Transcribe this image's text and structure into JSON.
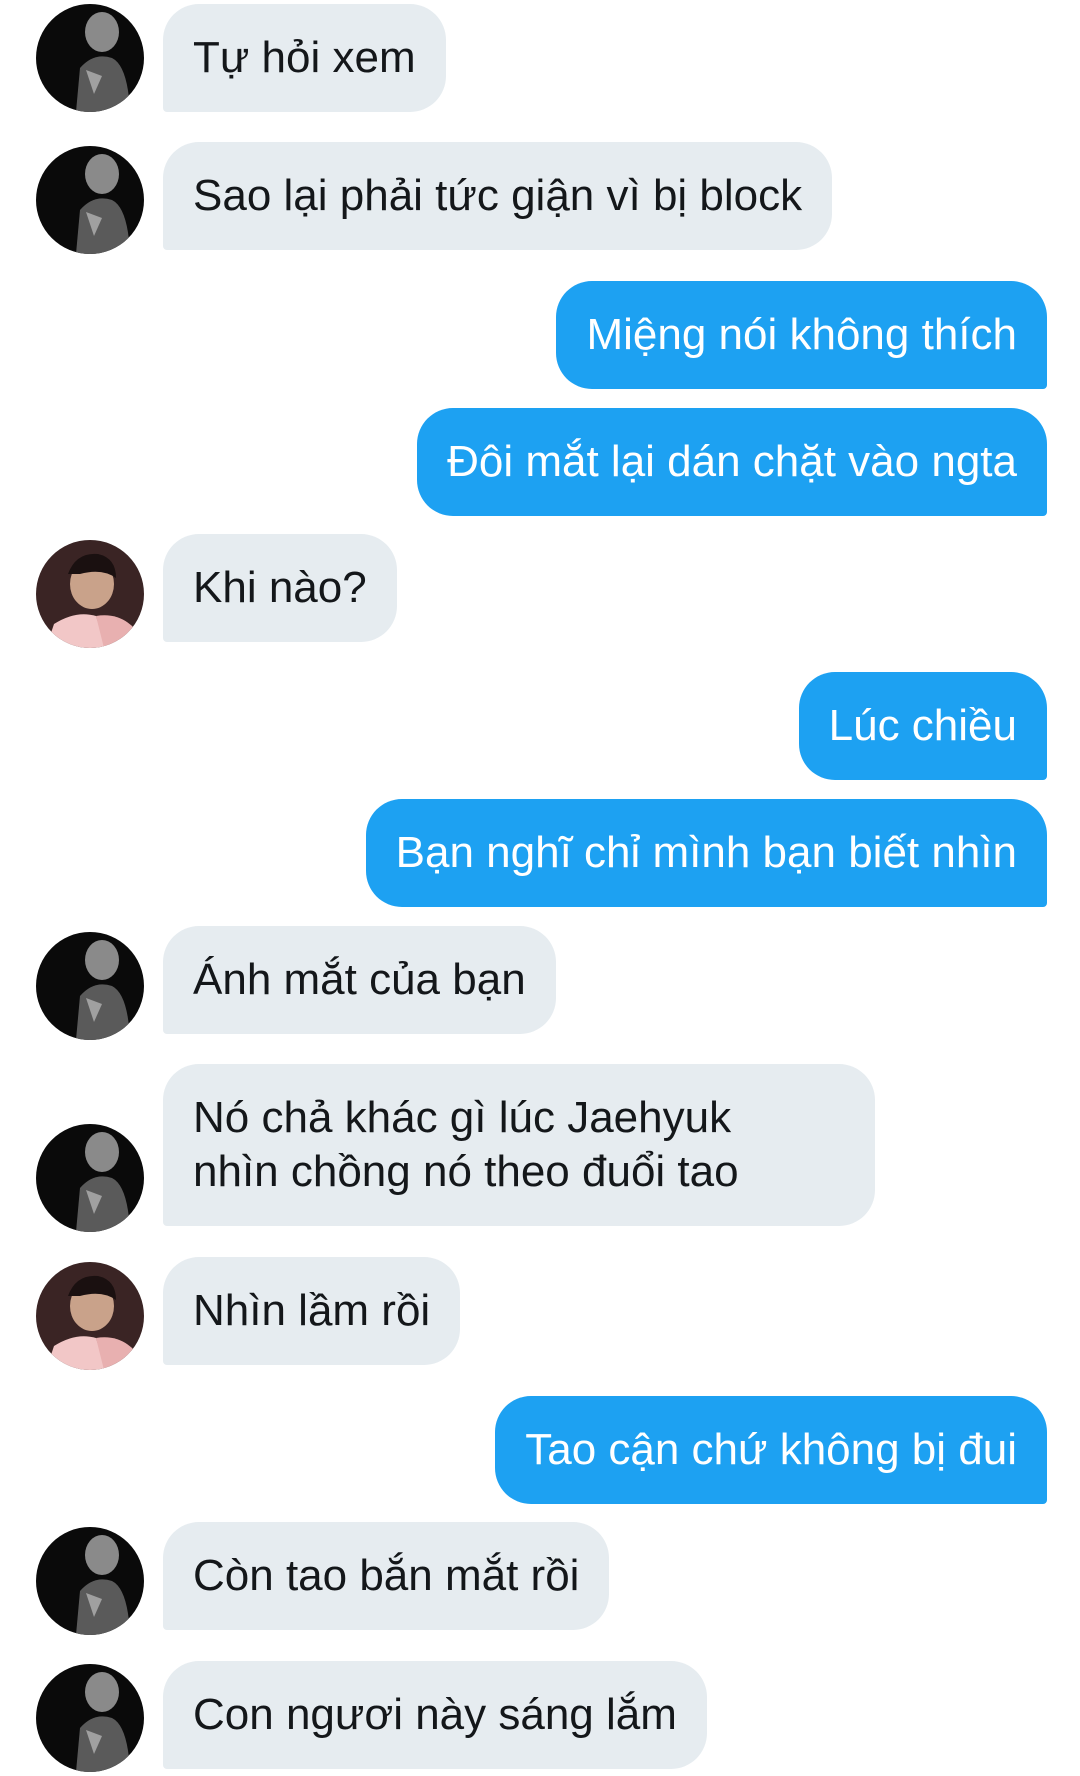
{
  "conversation": {
    "messages": [
      {
        "side": "in",
        "avatar": "dark-portrait",
        "text": "Tự hỏi xem"
      },
      {
        "side": "in",
        "avatar": "dark-portrait",
        "text": "Sao lại phải tức giận vì bị block"
      },
      {
        "side": "out",
        "text": "Miệng nói không thích"
      },
      {
        "side": "out",
        "text": "Đôi mắt lại dán chặt vào ngta"
      },
      {
        "side": "in",
        "avatar": "pink-portrait",
        "text": "Khi nào?"
      },
      {
        "side": "out",
        "text": "Lúc chiều"
      },
      {
        "side": "out",
        "text": "Bạn nghĩ chỉ mình bạn biết nhìn"
      },
      {
        "side": "in",
        "avatar": "dark-portrait",
        "text": "Ánh mắt của bạn"
      },
      {
        "side": "in",
        "avatar": "dark-portrait",
        "lines": [
          "Nó chả khác gì lúc Jaehyuk",
          "nhìn chồng nó theo đuổi tao"
        ]
      },
      {
        "side": "in",
        "avatar": "pink-portrait",
        "text": "Nhìn lầm rồi"
      },
      {
        "side": "out",
        "text": "Tao cận chứ không bị đui"
      },
      {
        "side": "in",
        "avatar": "dark-portrait",
        "text": "Còn tao bắn mắt rồi"
      },
      {
        "side": "in",
        "avatar": "dark-portrait",
        "text": "Con ngươi này sáng lắm"
      }
    ]
  },
  "colors": {
    "incoming_bubble": "#e6ecf0",
    "outgoing_bubble": "#1da1f2",
    "incoming_text": "#14171a",
    "outgoing_text": "#ffffff"
  }
}
